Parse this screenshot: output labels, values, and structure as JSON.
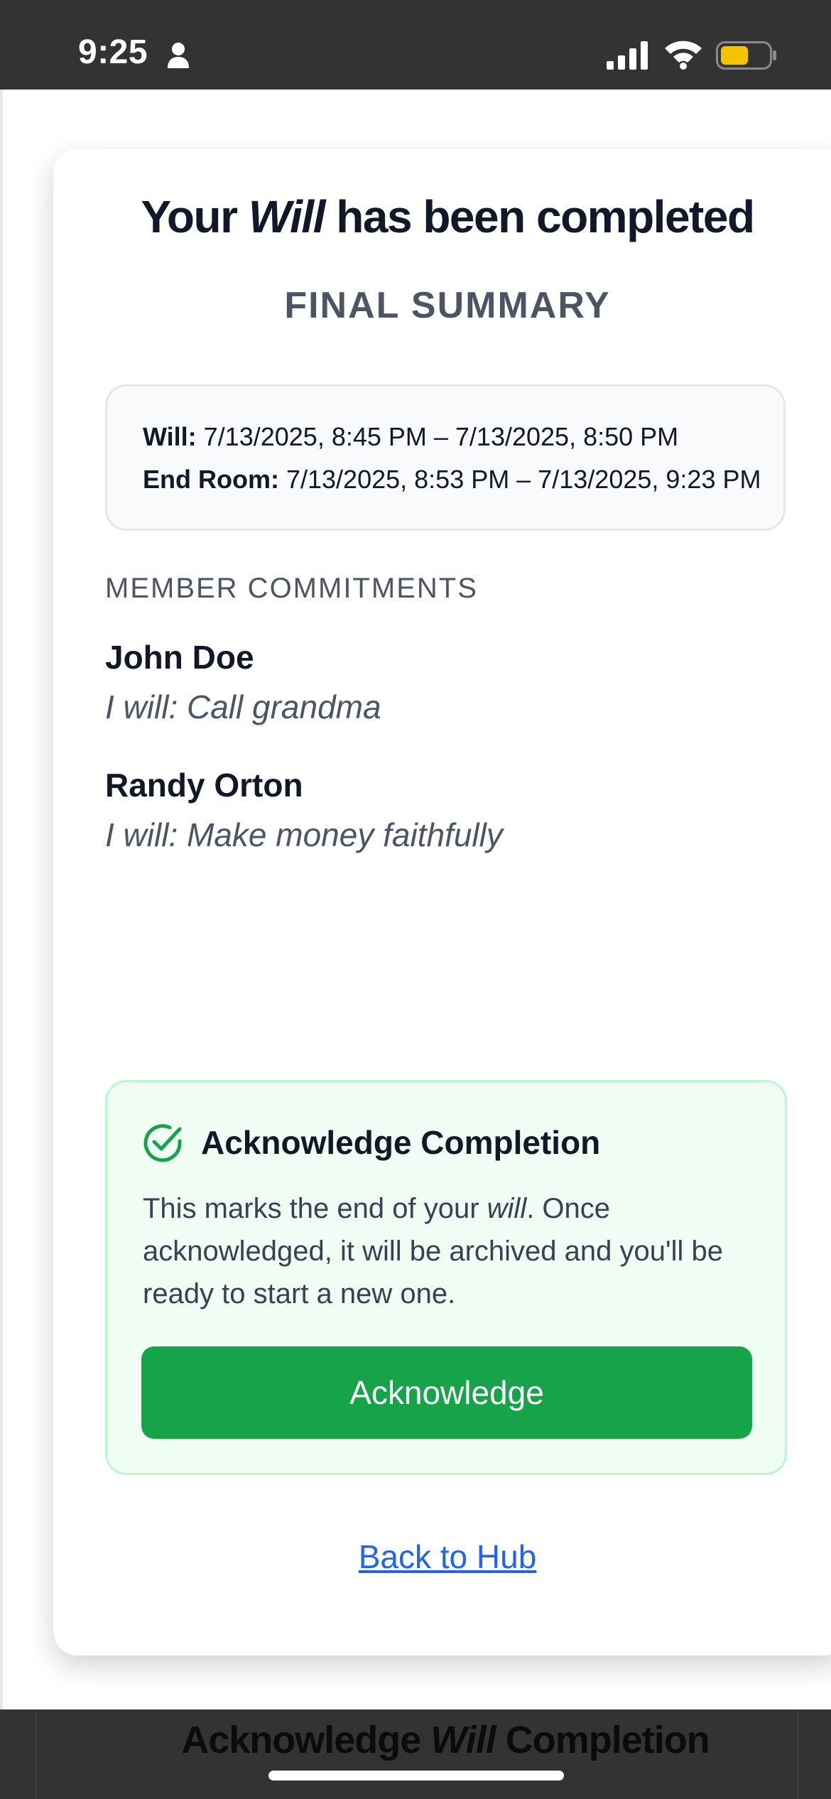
{
  "status_bar": {
    "time": "9:25",
    "icons": [
      "person-icon",
      "signal-icon",
      "wifi-icon",
      "battery-icon"
    ],
    "battery_color": "#f5c400"
  },
  "modal": {
    "title_prefix": "Your ",
    "title_emphasis": "Will",
    "title_suffix": " has been completed",
    "subtitle": "FINAL SUMMARY",
    "times": {
      "will_label": "Will:",
      "will_value": " 7/13/2025, 8:45 PM – 7/13/2025, 8:50 PM",
      "end_room_label": "End Room:",
      "end_room_value": " 7/13/2025, 8:53 PM – 7/13/2025, 9:23 PM"
    },
    "commitments_label": "MEMBER COMMITMENTS",
    "members": [
      {
        "name": "John Doe",
        "commitment": "I will: Call grandma"
      },
      {
        "name": "Randy Orton",
        "commitment": "I will: Make money faithfully"
      }
    ],
    "acknowledge": {
      "icon": "check-circle-icon",
      "title": "Acknowledge Completion",
      "desc_prefix": "This marks the end of your ",
      "desc_emphasis": "will",
      "desc_suffix": ". Once acknowledged, it will be archived and you'll be ready to start a new one.",
      "button_label": "Acknowledge",
      "accent_color": "#16a34a"
    },
    "back_link": "Back to Hub"
  },
  "background_header": {
    "title_prefix": "Acknowledge ",
    "title_emphasis": "Will",
    "title_suffix": " Completion"
  }
}
